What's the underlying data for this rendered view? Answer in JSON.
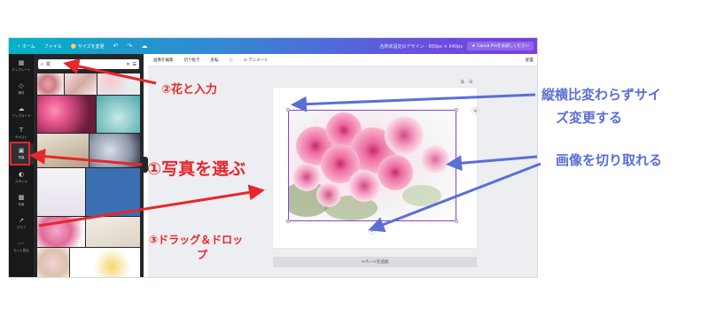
{
  "topbar": {
    "home": "ホーム",
    "file": "ファイル",
    "resize": "サイズを変更",
    "doc_title": "名称未設定のデザイン - 800px × 640px",
    "pro": "Canva Proをお試しください"
  },
  "rail": {
    "items": [
      "テンプレート",
      "素材",
      "アップロード",
      "テキスト",
      "写真",
      "スタイル",
      "背景",
      "グラフ",
      "もっと見る"
    ]
  },
  "search": {
    "value": "花"
  },
  "editor_toolbar": {
    "edit": "画像を編集",
    "crop": "切り抜き",
    "flip": "反転",
    "animate": "アニメート",
    "right": "配置"
  },
  "canvas": {
    "add_page": "+ページを追加"
  },
  "annotations": {
    "step2": "②花と入力",
    "step1": "①写真を選ぶ",
    "step3_line1": "③ドラッグ＆ドロッ",
    "step3_line2": "プ",
    "resize_line1": "縦横比変わらずサイ",
    "resize_line2": "ズ変更する",
    "crop_note": "画像を切り取れる"
  },
  "colors": {
    "annotation_red": "#e8262b",
    "annotation_blue": "#5a6fd6",
    "selection": "#8b3fd9"
  }
}
